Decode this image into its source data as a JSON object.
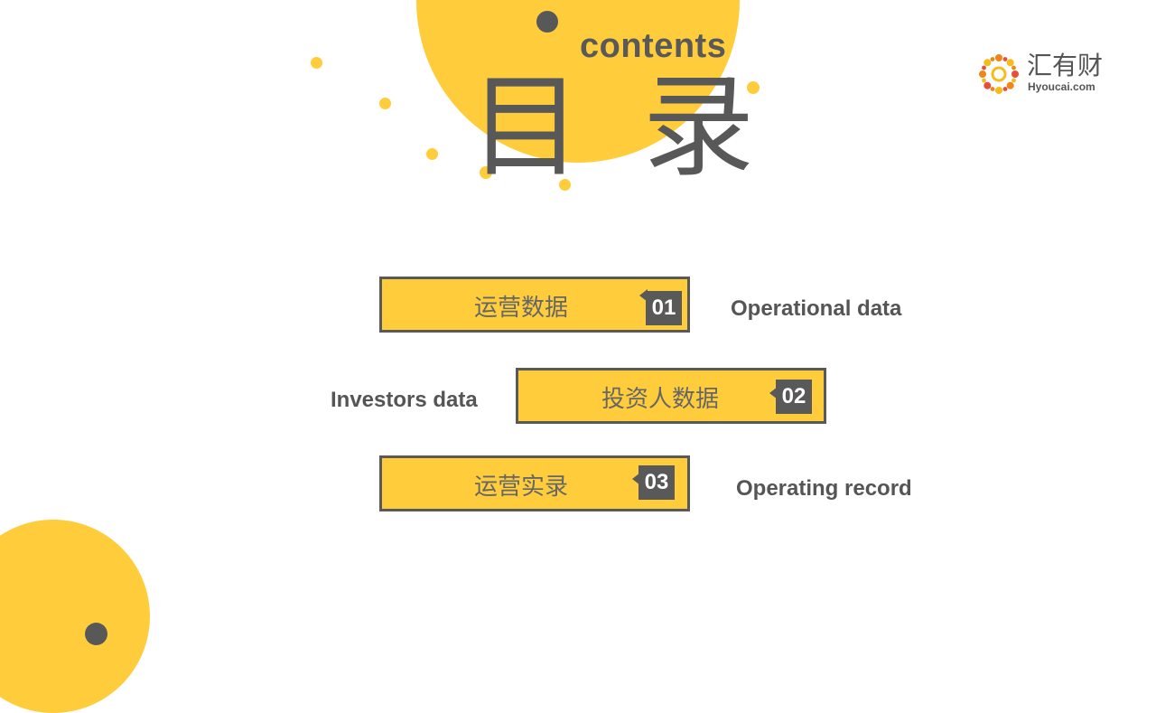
{
  "colors": {
    "accent_yellow": "#FFCD3C",
    "dark_gray": "#595959",
    "text_gray": "#555555",
    "logo_orange": "#F08519",
    "logo_red": "#E94E3A",
    "logo_gold": "#F6BC18"
  },
  "header": {
    "subtitle": "contents",
    "title": "目 录"
  },
  "logo": {
    "icon": "sun-flower-logo-icon",
    "name_cn": "汇有财",
    "domain": "Hyoucai.com"
  },
  "menu": {
    "items": [
      {
        "number": "01",
        "label_cn": "运营数据",
        "label_en": "Operational data"
      },
      {
        "number": "02",
        "label_cn": "投资人数据",
        "label_en": "Investors data"
      },
      {
        "number": "03",
        "label_cn": "运营实录",
        "label_en": "Operating record"
      }
    ]
  }
}
